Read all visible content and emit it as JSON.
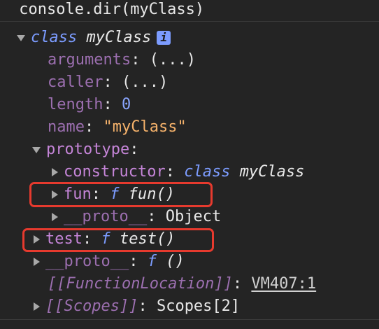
{
  "console": {
    "command": "console.dir(myClass)"
  },
  "tree": {
    "root": {
      "keyword": "class",
      "name": "myClass",
      "info": "i"
    },
    "arguments": {
      "key": "arguments",
      "sep": ":",
      "value": "(...)"
    },
    "caller": {
      "key": "caller",
      "sep": ":",
      "value": "(...)"
    },
    "length": {
      "key": "length",
      "sep": ":",
      "value": "0"
    },
    "name": {
      "key": "name",
      "sep": ":",
      "value": "\"myClass\""
    },
    "prototype": {
      "key": "prototype",
      "sep": ":"
    },
    "constructor": {
      "key": "constructor",
      "sep": ":",
      "keyword": "class",
      "value": "myClass"
    },
    "fun": {
      "key": "fun",
      "sep": ":",
      "keyword": "f",
      "value": "fun()"
    },
    "proto_inner": {
      "key": "__proto__",
      "sep": ":",
      "value": "Object"
    },
    "test": {
      "key": "test",
      "sep": ":",
      "keyword": "f",
      "value": "test()"
    },
    "proto_outer": {
      "key": "__proto__",
      "sep": ":",
      "keyword": "f",
      "value": "()"
    },
    "function_location": {
      "key": "[[FunctionLocation]]",
      "sep": ":",
      "link": "VM407:1"
    },
    "scopes": {
      "key": "[[Scopes]]",
      "sep": ":",
      "value": "Scopes[2]"
    }
  },
  "colors": {
    "background": "#242424",
    "highlight": "#e63a2e",
    "key": "#c585d8",
    "keyword": "#7c9cff",
    "string": "#f5b26b"
  },
  "icons": {
    "expanded": "triangle-down-icon",
    "collapsed": "triangle-right-icon",
    "info": "info-icon"
  }
}
